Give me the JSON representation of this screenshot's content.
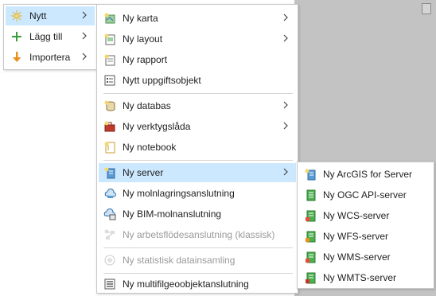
{
  "menu_main": {
    "items": [
      {
        "label": "Nytt",
        "icon": "sun-new-icon",
        "has_submenu": true,
        "active": true
      },
      {
        "label": "Lägg till",
        "icon": "plus-icon",
        "has_submenu": true
      },
      {
        "label": "Importera",
        "icon": "import-arrow-icon",
        "has_submenu": true
      }
    ]
  },
  "menu_new": {
    "items": [
      {
        "label": "Ny karta",
        "icon": "new-map-icon",
        "has_submenu": true
      },
      {
        "label": "Ny layout",
        "icon": "new-layout-icon",
        "has_submenu": true
      },
      {
        "label": "Ny rapport",
        "icon": "new-report-icon"
      },
      {
        "label": "Nytt uppgiftsobjekt",
        "icon": "task-item-icon"
      },
      {
        "label": "Ny databas",
        "icon": "new-database-icon",
        "has_submenu": true
      },
      {
        "label": "Ny verktygslåda",
        "icon": "new-toolbox-icon",
        "has_submenu": true
      },
      {
        "label": "Ny notebook",
        "icon": "new-notebook-icon"
      },
      {
        "label": "Ny server",
        "icon": "new-server-icon",
        "has_submenu": true,
        "active": true
      },
      {
        "label": "Ny molnlagringsanslutning",
        "icon": "cloud-storage-icon"
      },
      {
        "label": "Ny BIM-molnanslutning",
        "icon": "bim-cloud-icon"
      },
      {
        "label": "Ny arbetsflödesanslutning (klassisk)",
        "icon": "workflow-connection-icon",
        "disabled": true
      },
      {
        "label": "Ny statistisk datainsamling",
        "icon": "statistical-data-icon",
        "disabled": true
      },
      {
        "label": "Ny multifilgeoobjektanslutning",
        "icon": "multifile-feature-icon"
      }
    ]
  },
  "menu_server": {
    "items": [
      {
        "label": "Ny ArcGIS for Server",
        "icon": "arcgis-server-icon"
      },
      {
        "label": "Ny OGC API-server",
        "icon": "ogc-api-server-icon"
      },
      {
        "label": "Ny WCS-server",
        "icon": "wcs-server-icon"
      },
      {
        "label": "Ny WFS-server",
        "icon": "wfs-server-icon"
      },
      {
        "label": "Ny WMS-server",
        "icon": "wms-server-icon"
      },
      {
        "label": "Ny WMTS-server",
        "icon": "wmts-server-icon"
      }
    ]
  },
  "colors": {
    "highlight": "#cce8ff",
    "disabled_text": "#9a9a9a",
    "separator": "#d6d6d6",
    "background_panel": "#c3c3c3"
  }
}
